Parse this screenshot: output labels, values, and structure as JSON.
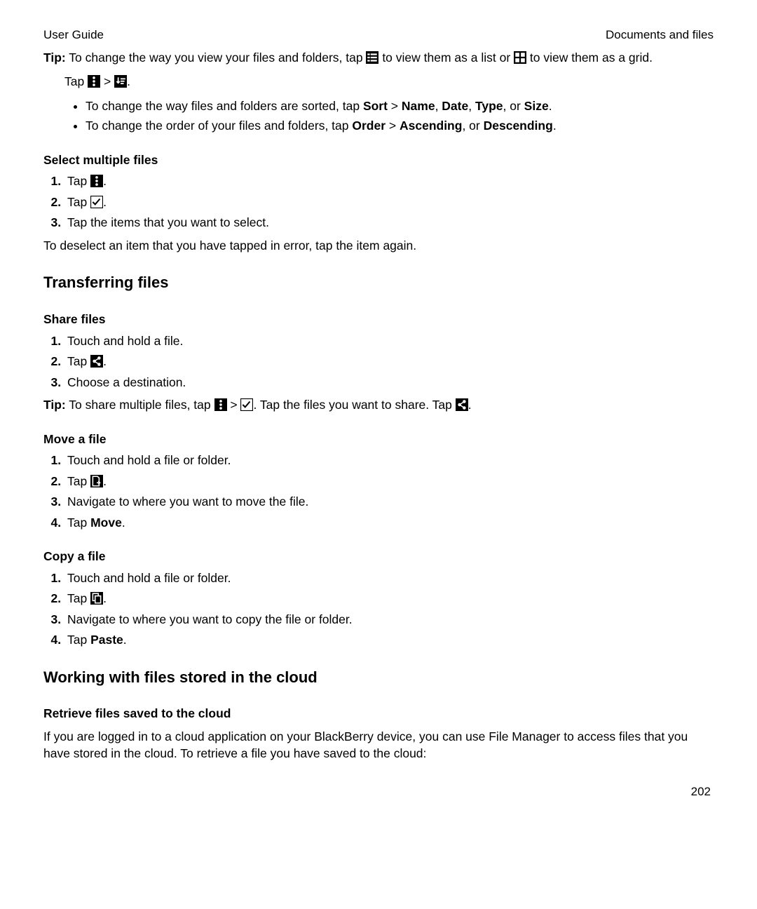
{
  "header": {
    "left": "User Guide",
    "right": "Documents and files"
  },
  "tip1": {
    "prefix": "Tip:",
    "a": " To change the way you view your files and folders, tap ",
    "b": " to view them as a list or ",
    "c": " to view them as a grid."
  },
  "tapLine": {
    "a": "Tap ",
    "gt": ">",
    "dot": "."
  },
  "bullets": {
    "b1": {
      "a": "To change the way files and folders are sorted, tap ",
      "sort": "Sort",
      "gt": " > ",
      "name": "Name",
      "c1": ", ",
      "date": "Date",
      "c2": ", ",
      "type": "Type",
      "c3": ", or ",
      "size": "Size",
      "dot": "."
    },
    "b2": {
      "a": "To change the order of your files and folders, tap ",
      "order": "Order",
      "gt": " > ",
      "asc": "Ascending",
      "c1": ", or ",
      "desc": "Descending",
      "dot": "."
    }
  },
  "selMulti": {
    "title": "Select multiple files",
    "s1": "Tap ",
    "s2": "Tap ",
    "s3": "Tap the items that you want to select.",
    "dot": ".",
    "note": "To deselect an item that you have tapped in error, tap the item again."
  },
  "transfer": {
    "title": "Transferring files"
  },
  "share": {
    "title": "Share files",
    "s1": "Touch and hold a file.",
    "s2": "Tap ",
    "s3": "Choose a destination.",
    "dot": ".",
    "tipPrefix": "Tip:",
    "tipA": " To share multiple files, tap ",
    "tipGt": " > ",
    "tipB": ". Tap the files you want to share. Tap ",
    "tipDot": "."
  },
  "move": {
    "title": "Move a file",
    "s1": "Touch and hold a file or folder.",
    "s2": "Tap ",
    "dot": ".",
    "s3": "Navigate to where you want to move the file.",
    "s4a": "Tap ",
    "s4b": "Move",
    "s4c": "."
  },
  "copy": {
    "title": "Copy a file",
    "s1": "Touch and hold a file or folder.",
    "s2": "Tap ",
    "dot": ".",
    "s3": "Navigate to where you want to copy the file or folder.",
    "s4a": "Tap ",
    "s4b": "Paste",
    "s4c": "."
  },
  "cloud": {
    "title": "Working with files stored in the cloud",
    "sub": "Retrieve files saved to the cloud",
    "p": "If you are logged in to a cloud application on your BlackBerry device, you can use File Manager to access files that you have stored in the cloud. To retrieve a file you have saved to the cloud:"
  },
  "pageNum": "202"
}
